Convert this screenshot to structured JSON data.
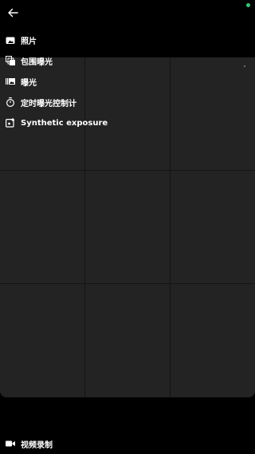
{
  "status": {
    "dot_color": "#2ecc71"
  },
  "header": {
    "back_icon": "arrow-left-icon"
  },
  "menu": {
    "items": [
      {
        "label": "照片",
        "icon": "camera-icon"
      },
      {
        "label": "包围曝光",
        "icon": "bracket-exposure-icon"
      },
      {
        "label": "曝光",
        "icon": "exposure-icon"
      },
      {
        "label": "定时曝光控制计",
        "icon": "timer-icon"
      },
      {
        "label": "Synthetic exposure",
        "icon": "synthetic-exposure-icon"
      }
    ]
  },
  "bottom": {
    "label": "视频录制",
    "icon": "video-camera-icon"
  },
  "colors": {
    "background": "#000000",
    "viewfinder": "#232323",
    "grid": "#141414"
  }
}
